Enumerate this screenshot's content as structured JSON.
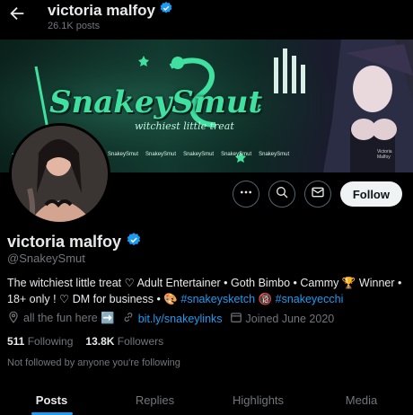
{
  "header": {
    "name": "victoria malfoy",
    "posts": "26.1K posts"
  },
  "banner": {
    "title": "SnakeySmut",
    "subtitle": "witchiest little treat",
    "socials": [
      "SnakeySmut",
      "SnakeySmut",
      "SnakeySmut",
      "SnakeySmut",
      "SnakeySmut"
    ],
    "artist_sig": "Victoria Malfoy",
    "colors": {
      "green": "#3fe0a0",
      "dark": "#0b201b"
    }
  },
  "actions": {
    "follow_label": "Follow"
  },
  "profile": {
    "name": "victoria malfoy",
    "handle": "@SnakeySmut",
    "bio_line1": "The witchiest little treat ♡ Adult Entertainer • Goth Bimbo • Cammy 🏆 Winner •",
    "bio_line2_a": "18+ only ! ♡ DM for business • 🎨",
    "bio_tag1": "#snakeysketch",
    "bio_mid": "🔞",
    "bio_tag2": "#snakeyecchi",
    "location": "all the fun here ➡️",
    "link": "bit.ly/snakeylinks",
    "joined": "Joined June 2020",
    "following_count": "511",
    "following_label": "Following",
    "followers_count": "13.8K",
    "followers_label": "Followers",
    "followed_by": "Not followed by anyone you're following"
  },
  "tabs": [
    "Posts",
    "Replies",
    "Highlights",
    "Media"
  ],
  "colors": {
    "accent": "#1d9bf0",
    "muted": "#71767b",
    "text": "#e7e9ea"
  }
}
